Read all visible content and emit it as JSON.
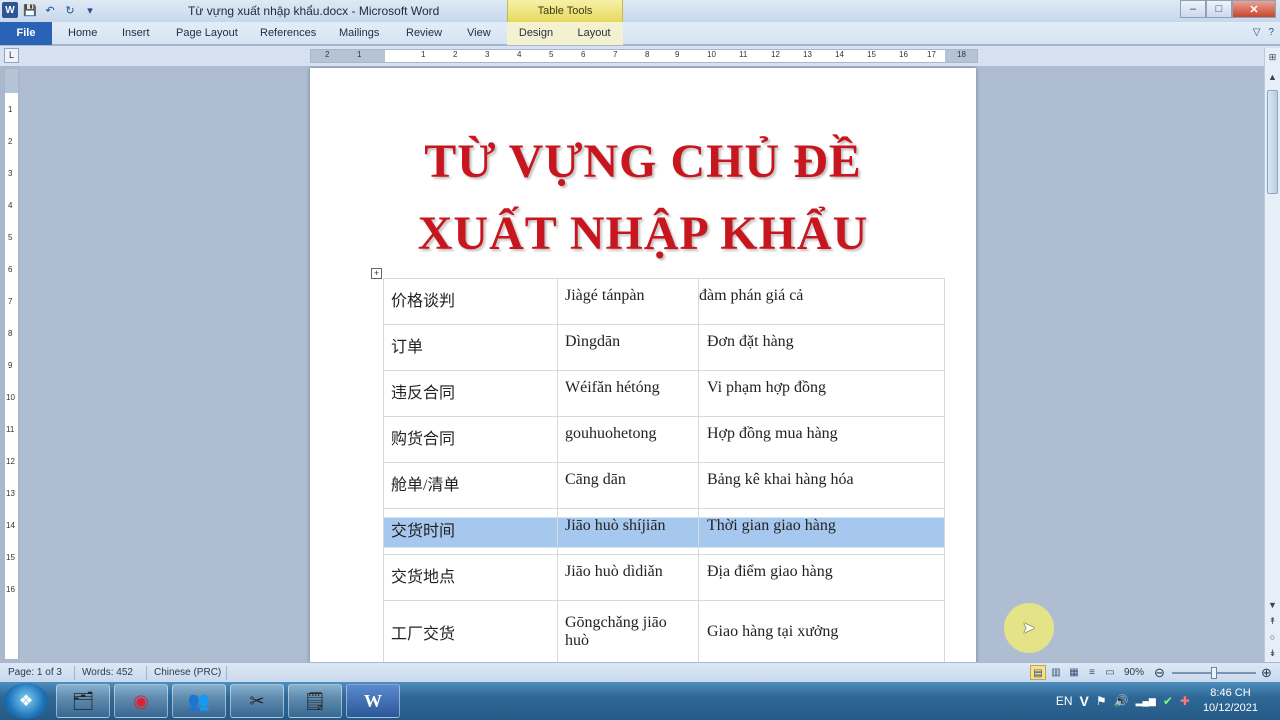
{
  "window": {
    "title": "Từ vựng  xuất nhập khẩu.docx  -  Microsoft Word",
    "contextual_group": "Table Tools",
    "controls": {
      "minimize": "–",
      "maximize": "□",
      "close": "✕"
    }
  },
  "qat": {
    "word_icon": "W",
    "save_icon": "💾",
    "undo_icon": "↶",
    "redo_icon": "↻",
    "customize_icon": "▾"
  },
  "ribbon": {
    "file_tab": "File",
    "tabs": [
      "Home",
      "Insert",
      "Page Layout",
      "References",
      "Mailings",
      "Review",
      "View",
      "Design",
      "Layout"
    ],
    "help_icon": "?",
    "minimize_icon": "▽"
  },
  "ruler": {
    "corner": "L",
    "h_labels": [
      "2",
      "1",
      "1",
      "2",
      "3",
      "4",
      "5",
      "6",
      "7",
      "8",
      "9",
      "10",
      "11",
      "12",
      "13",
      "14",
      "15",
      "16",
      "17",
      "18"
    ],
    "v_labels": [
      "1",
      "2",
      "3",
      "4",
      "5",
      "6",
      "7",
      "8",
      "9",
      "10",
      "11",
      "12",
      "13",
      "14",
      "15",
      "16"
    ]
  },
  "document": {
    "title_line1": "TỪ VỰNG CHỦ ĐỀ",
    "title_line2": "XUẤT NHẬP KHẨU",
    "table_handle_icon": "+",
    "rows": [
      {
        "chinese": "价格谈判",
        "pinyin": "Jiàgé tánpàn",
        "vietnamese": "đàm phán giá cả"
      },
      {
        "chinese": "订单",
        "pinyin": "Dìngdān",
        "vietnamese": "Đơn đặt hàng"
      },
      {
        "chinese": "违反合同",
        "pinyin": "Wéifǎn hétóng",
        "vietnamese": "Vi phạm hợp đồng"
      },
      {
        "chinese": "购货合同",
        "pinyin": "gouhuohetong",
        "vietnamese": "Hợp đồng mua hàng"
      },
      {
        "chinese": "舱单/清单",
        "pinyin": "Cāng dān",
        "vietnamese": "Bảng kê khai hàng hóa"
      },
      {
        "chinese": "交货时间",
        "pinyin": "Jiāo huò shíjiān",
        "vietnamese": "Thời gian giao hàng"
      },
      {
        "chinese": "交货地点",
        "pinyin": "Jiāo huò dìdiǎn",
        "vietnamese": "Địa điểm giao hàng"
      },
      {
        "chinese": "工厂交货",
        "pinyin": "Gōngchǎng jiāo huò",
        "vietnamese": "Giao hàng tại xưởng"
      }
    ],
    "selected_row": 5
  },
  "scrollbar": {
    "up_icon": "▲",
    "down_icon": "▼",
    "prev_icon": "↟",
    "browse_icon": "○",
    "next_icon": "↡",
    "split_icon": "⊟",
    "ruler_toggle_icon": "⊞"
  },
  "statusbar": {
    "page": "Page: 1 of 3",
    "words": "Words: 452",
    "language": "Chinese (PRC)",
    "zoom": "90%",
    "zoom_fraction": 0.5,
    "zoom_out_icon": "⊖",
    "zoom_in_icon": "⊕",
    "view_icons": [
      "▤",
      "▥",
      "▦",
      "≡",
      "▭"
    ]
  },
  "taskbar": {
    "start_icon": "❖",
    "apps": [
      {
        "name": "explorer-app",
        "icon": "🗂"
      },
      {
        "name": "chrome-app",
        "icon": "◉"
      },
      {
        "name": "teams-app",
        "icon": "👥"
      },
      {
        "name": "snipping-app",
        "icon": "✂"
      },
      {
        "name": "sticky-notes-app",
        "icon": "🗒"
      },
      {
        "name": "word-app",
        "icon": "W"
      }
    ],
    "tray": {
      "language": "EN",
      "ime_icon": "V",
      "flag_icon": "⚑",
      "volume_icon": "🔊",
      "network_icon": "▂▄▆",
      "security_icon": "✔",
      "app_icon": "✚",
      "time": "8:46 CH",
      "date": "10/12/2021"
    }
  }
}
